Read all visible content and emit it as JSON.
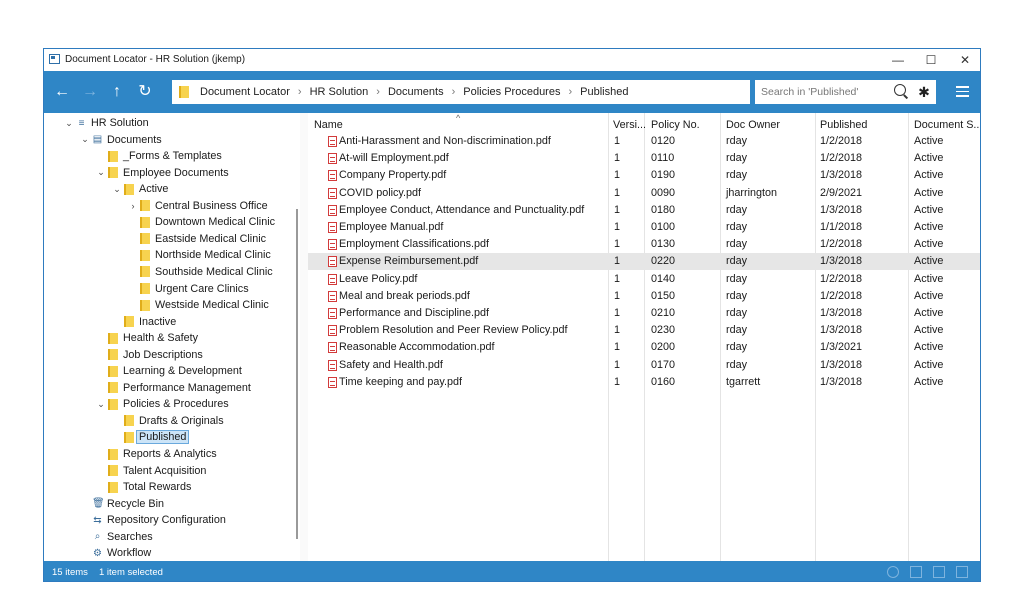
{
  "window": {
    "title": "Document Locator - HR Solution (jkemp)"
  },
  "window_controls": {
    "minimize": "—",
    "maximize": "☐",
    "close": "✕"
  },
  "nav": {
    "back": "←",
    "forward": "→",
    "up": "↑",
    "refresh": "↻"
  },
  "breadcrumb": [
    "Document Locator",
    "HR Solution",
    "Documents",
    "Policies  Procedures",
    "Published"
  ],
  "breadcrumb_separator": "›",
  "search": {
    "placeholder": "Search in 'Published'"
  },
  "tree": [
    {
      "label": "HR Solution",
      "chevron": "⌄",
      "icon": "stack",
      "depth": 0
    },
    {
      "label": "Documents",
      "chevron": "⌄",
      "icon": "doc",
      "depth": 1
    },
    {
      "label": "_Forms & Templates",
      "chevron": "",
      "icon": "folder",
      "depth": 2
    },
    {
      "label": "Employee Documents",
      "chevron": "⌄",
      "icon": "folder",
      "depth": 2
    },
    {
      "label": "Active",
      "chevron": "⌄",
      "icon": "folder",
      "depth": 3
    },
    {
      "label": "Central Business Office",
      "chevron": "›",
      "icon": "folder",
      "depth": 4
    },
    {
      "label": "Downtown Medical Clinic",
      "chevron": "",
      "icon": "folder",
      "depth": 4
    },
    {
      "label": "Eastside Medical Clinic",
      "chevron": "",
      "icon": "folder",
      "depth": 4
    },
    {
      "label": "Northside Medical Clinic",
      "chevron": "",
      "icon": "folder",
      "depth": 4
    },
    {
      "label": "Southside Medical Clinic",
      "chevron": "",
      "icon": "folder",
      "depth": 4
    },
    {
      "label": "Urgent Care Clinics",
      "chevron": "",
      "icon": "folder",
      "depth": 4
    },
    {
      "label": "Westside Medical Clinic",
      "chevron": "",
      "icon": "folder",
      "depth": 4
    },
    {
      "label": "Inactive",
      "chevron": "",
      "icon": "folder",
      "depth": 3
    },
    {
      "label": "Health & Safety",
      "chevron": "",
      "icon": "folder",
      "depth": 2
    },
    {
      "label": "Job Descriptions",
      "chevron": "",
      "icon": "folder",
      "depth": 2
    },
    {
      "label": "Learning & Development",
      "chevron": "",
      "icon": "folder",
      "depth": 2
    },
    {
      "label": "Performance Management",
      "chevron": "",
      "icon": "folder",
      "depth": 2
    },
    {
      "label": "Policies & Procedures",
      "chevron": "⌄",
      "icon": "folder",
      "depth": 2
    },
    {
      "label": "Drafts & Originals",
      "chevron": "",
      "icon": "folder",
      "depth": 3
    },
    {
      "label": "Published",
      "chevron": "",
      "icon": "folder",
      "depth": 3,
      "selected": true
    },
    {
      "label": "Reports & Analytics",
      "chevron": "",
      "icon": "folder",
      "depth": 2
    },
    {
      "label": "Talent Acquisition",
      "chevron": "",
      "icon": "folder",
      "depth": 2
    },
    {
      "label": "Total Rewards",
      "chevron": "",
      "icon": "folder",
      "depth": 2
    },
    {
      "label": "Recycle Bin",
      "chevron": "",
      "icon": "trash",
      "depth": 1
    },
    {
      "label": "Repository Configuration",
      "chevron": "",
      "icon": "sliders",
      "depth": 1
    },
    {
      "label": "Searches",
      "chevron": "",
      "icon": "search",
      "depth": 1
    },
    {
      "label": "Workflow",
      "chevron": "",
      "icon": "gear",
      "depth": 1
    }
  ],
  "columns": [
    "Name",
    "Versi...",
    "Policy No.",
    "Doc Owner",
    "Published",
    "Document S..."
  ],
  "sort_indicator": "^",
  "files": [
    {
      "name": "Anti-Harassment and Non-discrimination.pdf",
      "version": "1",
      "policy": "0120",
      "owner": "rday",
      "published": "1/2/2018",
      "status": "Active"
    },
    {
      "name": "At-will Employment.pdf",
      "version": "1",
      "policy": "0110",
      "owner": "rday",
      "published": "1/2/2018",
      "status": "Active"
    },
    {
      "name": "Company Property.pdf",
      "version": "1",
      "policy": "0190",
      "owner": "rday",
      "published": "1/3/2018",
      "status": "Active"
    },
    {
      "name": "COVID policy.pdf",
      "version": "1",
      "policy": "0090",
      "owner": "jharrington",
      "published": "2/9/2021",
      "status": "Active"
    },
    {
      "name": "Employee Conduct, Attendance and Punctuality.pdf",
      "version": "1",
      "policy": "0180",
      "owner": "rday",
      "published": "1/3/2018",
      "status": "Active"
    },
    {
      "name": "Employee Manual.pdf",
      "version": "1",
      "policy": "0100",
      "owner": "rday",
      "published": "1/1/2018",
      "status": "Active"
    },
    {
      "name": "Employment Classifications.pdf",
      "version": "1",
      "policy": "0130",
      "owner": "rday",
      "published": "1/2/2018",
      "status": "Active"
    },
    {
      "name": "Expense Reimbursement.pdf",
      "version": "1",
      "policy": "0220",
      "owner": "rday",
      "published": "1/3/2018",
      "status": "Active",
      "highlight": true
    },
    {
      "name": "Leave Policy.pdf",
      "version": "1",
      "policy": "0140",
      "owner": "rday",
      "published": "1/2/2018",
      "status": "Active"
    },
    {
      "name": "Meal and break periods.pdf",
      "version": "1",
      "policy": "0150",
      "owner": "rday",
      "published": "1/2/2018",
      "status": "Active"
    },
    {
      "name": "Performance and Discipline.pdf",
      "version": "1",
      "policy": "0210",
      "owner": "rday",
      "published": "1/3/2018",
      "status": "Active"
    },
    {
      "name": "Problem Resolution and Peer Review Policy.pdf",
      "version": "1",
      "policy": "0230",
      "owner": "rday",
      "published": "1/3/2018",
      "status": "Active"
    },
    {
      "name": "Reasonable Accommodation.pdf",
      "version": "1",
      "policy": "0200",
      "owner": "rday",
      "published": "1/3/2021",
      "status": "Active"
    },
    {
      "name": "Safety and Health.pdf",
      "version": "1",
      "policy": "0170",
      "owner": "rday",
      "published": "1/3/2018",
      "status": "Active"
    },
    {
      "name": "Time keeping and pay.pdf",
      "version": "1",
      "policy": "0160",
      "owner": "tgarrett",
      "published": "1/3/2018",
      "status": "Active"
    }
  ],
  "status": {
    "items": "15 items",
    "selected": "1 item selected"
  },
  "colors": {
    "accent": "#2f86c6",
    "folder": "#f7d34f",
    "pdf": "#d23b3b",
    "selection": "#cce4f7",
    "row_highlight": "#e6e6e6"
  }
}
